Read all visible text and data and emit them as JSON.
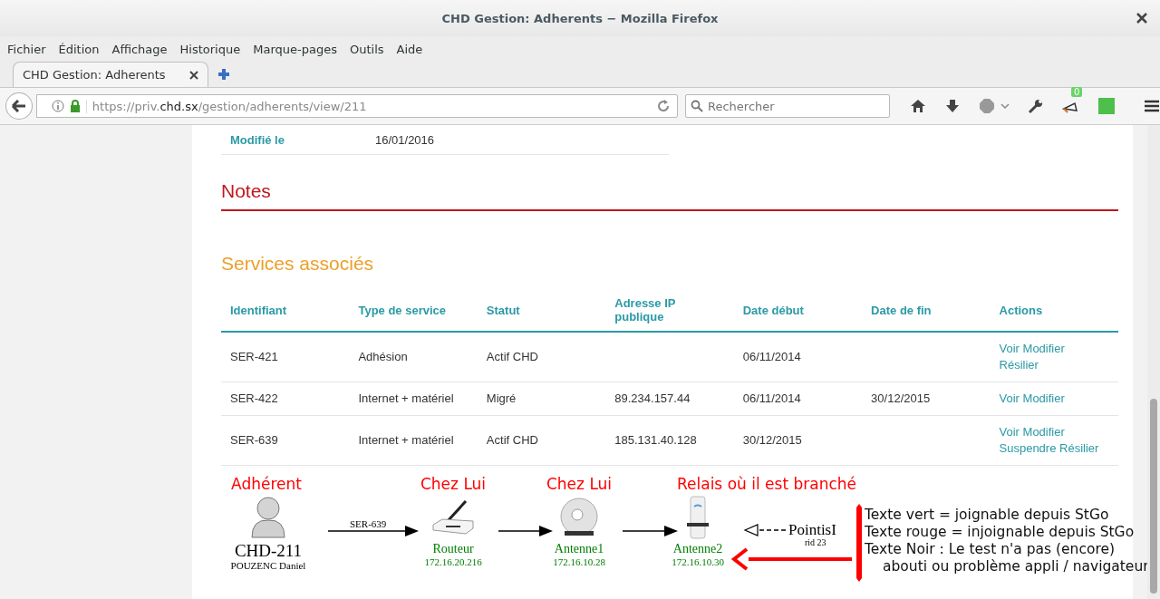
{
  "window": {
    "title": "CHD Gestion: Adherents − Mozilla Firefox"
  },
  "menu": [
    "Fichier",
    "Édition",
    "Affichage",
    "Historique",
    "Marque-pages",
    "Outils",
    "Aide"
  ],
  "tabs": [
    {
      "label": "CHD Gestion: Adherents",
      "selected": true
    }
  ],
  "address": {
    "prefix": "https://priv.",
    "domain": "chd.sx",
    "path": "/gestion/adherents/view/211"
  },
  "search": {
    "placeholder": "Rechercher"
  },
  "toolbar_badge": "0",
  "details": [
    {
      "label": "Modifié le",
      "value": "16/01/2016"
    }
  ],
  "notes": {
    "title": "Notes"
  },
  "services": {
    "title": "Services associés",
    "columns": [
      "Identifiant",
      "Type de service",
      "Statut",
      "Adresse IP publique",
      "Date début",
      "Date de fin",
      "Actions"
    ],
    "rows": [
      {
        "cells": [
          "SER-421",
          "Adhésion",
          "Actif CHD",
          "",
          "06/11/2014",
          ""
        ],
        "actions": [
          "Voir",
          "Modifier",
          "Résilier"
        ]
      },
      {
        "cells": [
          "SER-422",
          "Internet + matériel",
          "Migré",
          "89.234.157.44",
          "06/11/2014",
          "30/12/2015"
        ],
        "actions": [
          "Voir",
          "Modifier"
        ]
      },
      {
        "cells": [
          "SER-639",
          "Internet + matériel",
          "Actif CHD",
          "185.131.40.128",
          "30/12/2015",
          ""
        ],
        "actions": [
          "Voir",
          "Modifier",
          "Suspendre",
          "Résilier"
        ]
      }
    ]
  },
  "diagram": {
    "nodes": [
      {
        "kind": "person",
        "heading": "Adhérent",
        "label": "CHD-211",
        "sublabel": "POUZENC Daniel",
        "color": "#000000"
      },
      {
        "kind": "router",
        "heading": "Chez Lui",
        "label": "Routeur",
        "sublabel": "172.16.20.216",
        "color": "#008000"
      },
      {
        "kind": "dish",
        "heading": "Chez Lui",
        "label": "Antenne1",
        "sublabel": "172.16.10.28",
        "color": "#008000"
      },
      {
        "kind": "station",
        "heading": "Relais où il est branché",
        "label": "Antenne2",
        "sublabel": "172.16.10.30",
        "color": "#008000"
      }
    ],
    "link_label": "SER-639",
    "relay": {
      "label": "PointisI",
      "sublabel": "rid 23"
    },
    "legend": [
      "Texte vert = joignable depuis StGo",
      "Texte rouge = injoignable depuis StGo",
      "Texte Noir : Le test n'a pas (encore)",
      "abouti ou problème appli / navigateur"
    ]
  }
}
